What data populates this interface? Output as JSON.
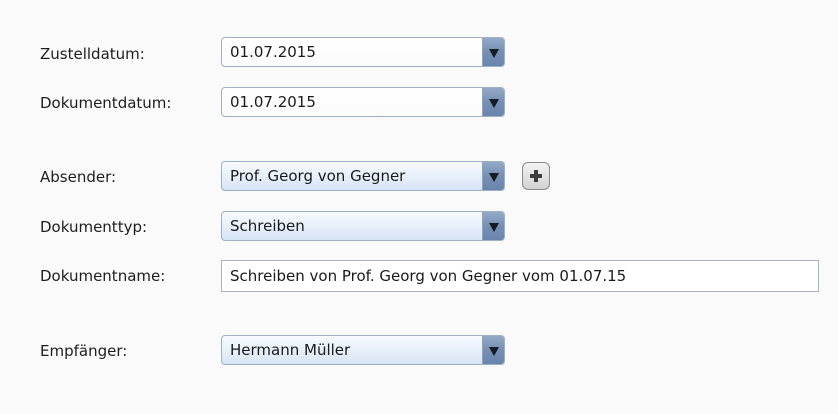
{
  "form": {
    "zustelldatum": {
      "label": "Zustelldatum:",
      "value": "01.07.2015"
    },
    "dokumentdatum": {
      "label": "Dokumentdatum:",
      "value": "01.07.2015"
    },
    "absender": {
      "label": "Absender:",
      "value": "Prof. Georg von Gegner",
      "add_icon": "plus-icon"
    },
    "dokumenttyp": {
      "label": "Dokumenttyp:",
      "value": "Schreiben"
    },
    "dokumentname": {
      "label": "Dokumentname:",
      "value": "Schreiben von Prof. Georg von Gegner vom 01.07.15"
    },
    "empfaenger": {
      "label": "Empfänger:",
      "value": "Hermann Müller"
    }
  },
  "colors": {
    "background": "#fafafa",
    "arrow_button": "#7690b4",
    "select_fill": "#e6effa"
  }
}
